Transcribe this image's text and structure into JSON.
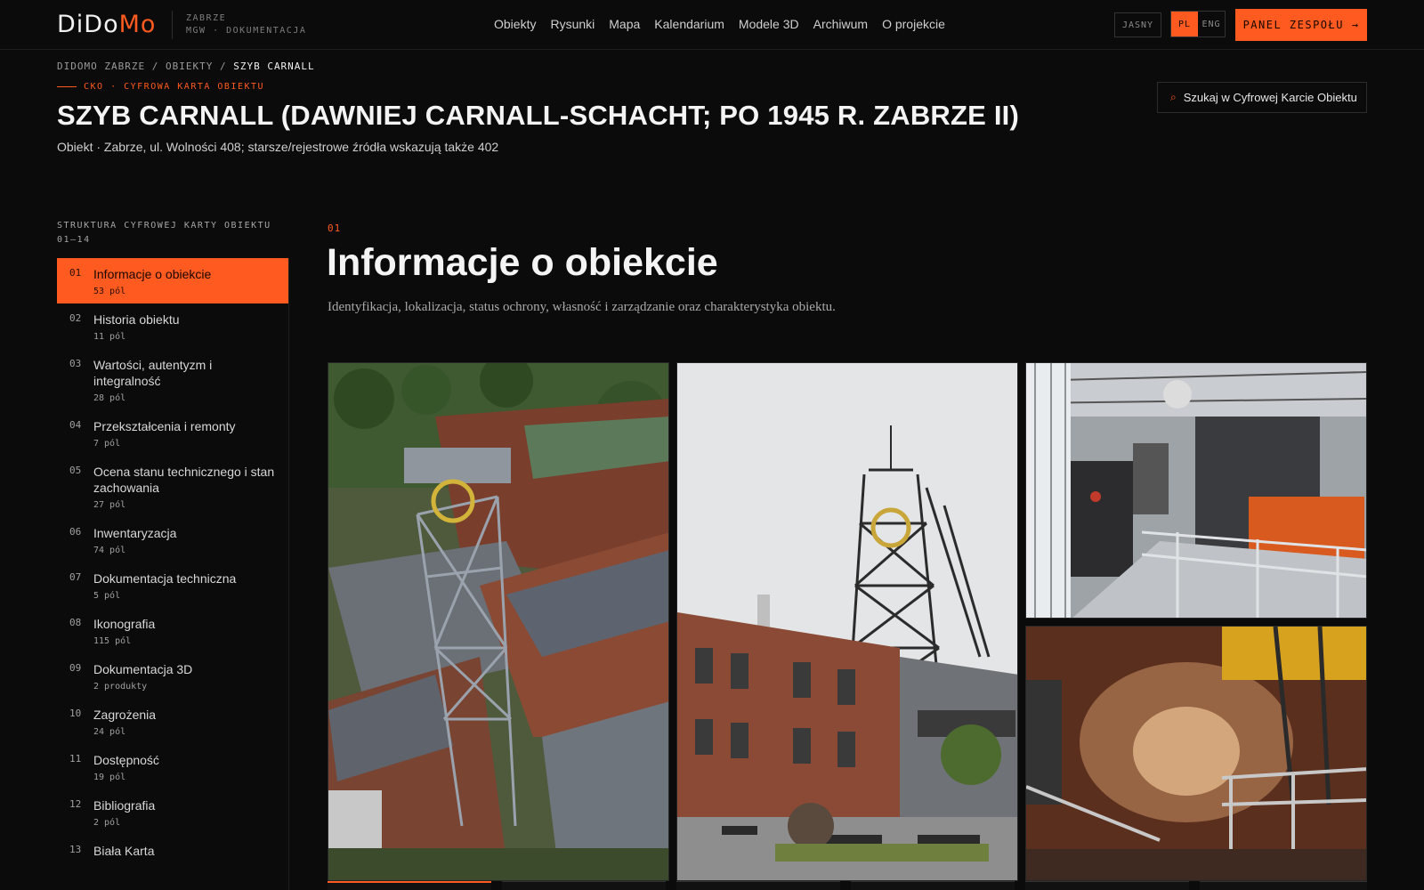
{
  "header": {
    "logo_part1": "DiDo",
    "logo_part2": "Mo",
    "logo_sub_line1": "ZABRZE",
    "logo_sub_line2": "MGW · DOKUMENTACJA",
    "nav": [
      "Obiekty",
      "Rysunki",
      "Mapa",
      "Kalendarium",
      "Modele 3D",
      "Archiwum",
      "O projekcie"
    ],
    "theme_label": "JASNY",
    "lang_pl": "PL",
    "lang_eng": "ENG",
    "panel_label": "PANEL ZESPOŁU →"
  },
  "breadcrumb": {
    "home": "DIDOMO ZABRZE",
    "sep": "/",
    "section": "OBIEKTY",
    "current": "SZYB CARNALL"
  },
  "page": {
    "eyebrow": "CKO · CYFROWA KARTA OBIEKTU",
    "title": "SZYB CARNALL (DAWNIEJ CARNALL-SCHACHT; PO 1945 R. ZABRZE II)",
    "subtitle": "Obiekt · Zabrze, ul. Wolności 408; starsze/rejestrowe źródła wskazują także 402",
    "search_label": "Szukaj w Cyfrowej Karcie Obiektu",
    "search_icon": "⌕"
  },
  "sidebar": {
    "heading_line1": "STRUKTURA CYFROWEJ KARTY OBIEKTU",
    "heading_line2": "01–14",
    "items": [
      {
        "num": "01",
        "label": "Informacje o obiekcie",
        "count": "53 pól"
      },
      {
        "num": "02",
        "label": "Historia obiektu",
        "count": "11 pól"
      },
      {
        "num": "03",
        "label": "Wartości, autentyzm i integralność",
        "count": "28 pól"
      },
      {
        "num": "04",
        "label": "Przekształcenia i remonty",
        "count": "7 pól"
      },
      {
        "num": "05",
        "label": "Ocena stanu technicznego i stan zachowania",
        "count": "27 pól"
      },
      {
        "num": "06",
        "label": "Inwentaryzacja",
        "count": "74 pól"
      },
      {
        "num": "07",
        "label": "Dokumentacja techniczna",
        "count": "5 pól"
      },
      {
        "num": "08",
        "label": "Ikonografia",
        "count": "115 pól"
      },
      {
        "num": "09",
        "label": "Dokumentacja 3D",
        "count": "2 produkty"
      },
      {
        "num": "10",
        "label": "Zagrożenia",
        "count": "24 pól"
      },
      {
        "num": "11",
        "label": "Dostępność",
        "count": "19 pól"
      },
      {
        "num": "12",
        "label": "Bibliografia",
        "count": "2 pól"
      },
      {
        "num": "13",
        "label": "Biała Karta",
        "count": ""
      }
    ]
  },
  "section": {
    "num": "01",
    "title": "Informacje o obiekcie",
    "description": "Identyfikacja, lokalizacja, status ochrony, własność i zarządzanie oraz charakterystyka obiektu."
  },
  "colors": {
    "accent": "#ff5a1f",
    "background": "#0b0b0b"
  }
}
